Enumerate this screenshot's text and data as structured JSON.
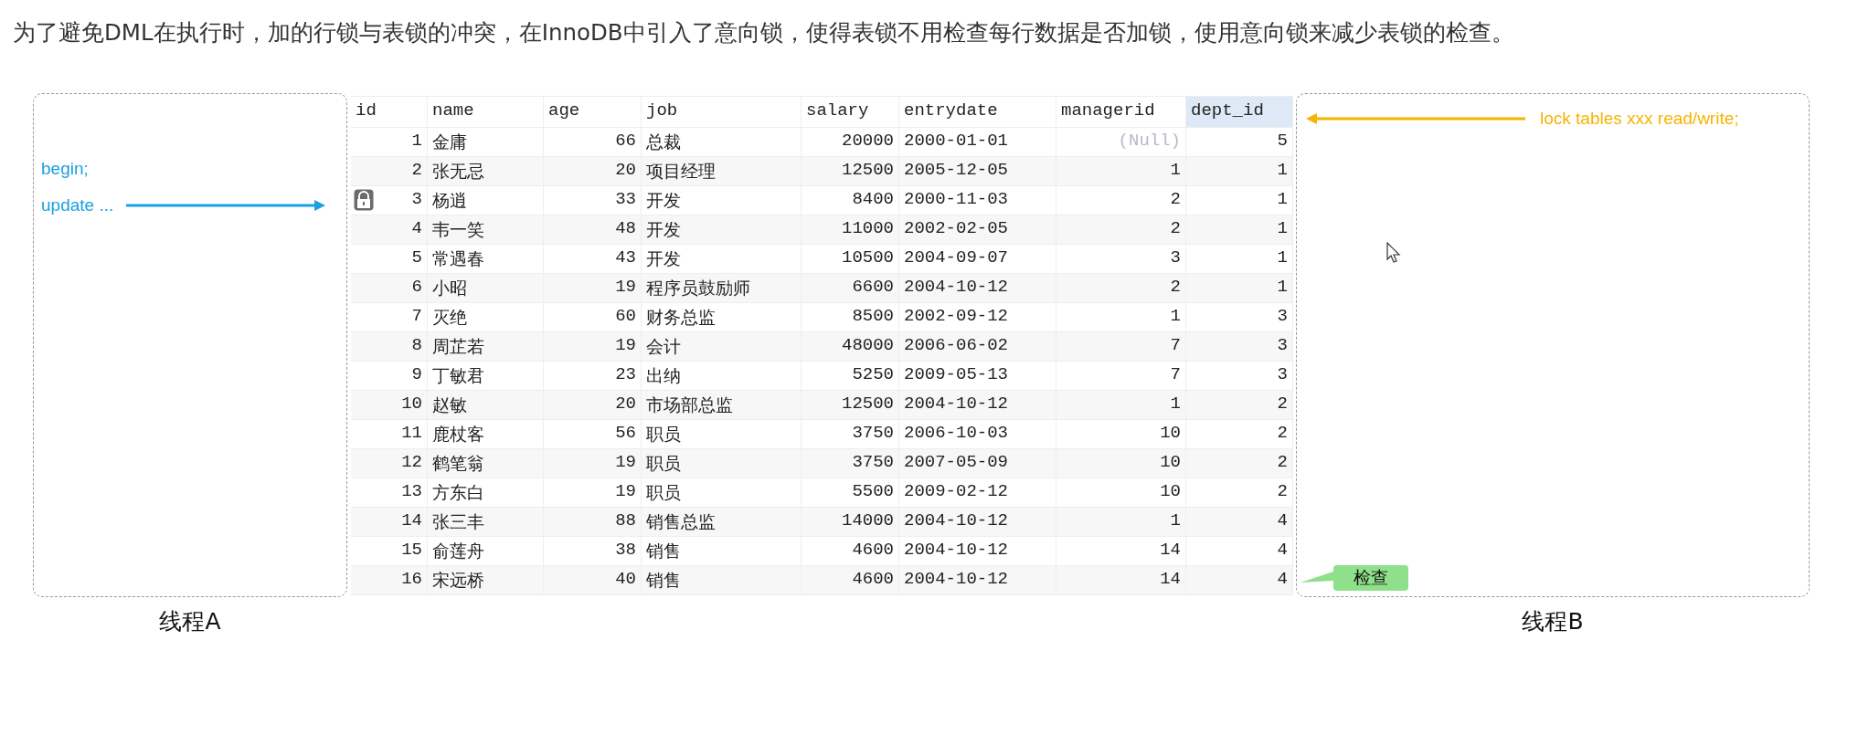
{
  "paragraph": "为了避免DML在执行时，加的行锁与表锁的冲突，在InnoDB中引入了意向锁，使得表锁不用检查每行数据是否加锁，使用意向锁来减少表锁的检查。",
  "thread_a": {
    "label": "线程A",
    "lines": [
      "begin;",
      "update ..."
    ]
  },
  "thread_b": {
    "label": "线程B",
    "command": "lock tables xxx read/write;",
    "badge": "检查"
  },
  "table": {
    "null_label": "(Null)",
    "columns": [
      {
        "label": "id",
        "selected": false
      },
      {
        "label": "name",
        "selected": false
      },
      {
        "label": "age",
        "selected": false
      },
      {
        "label": "job",
        "selected": false
      },
      {
        "label": "salary",
        "selected": false
      },
      {
        "label": "entrydate",
        "selected": false
      },
      {
        "label": "managerid",
        "selected": false
      },
      {
        "label": "dept_id",
        "selected": true
      }
    ],
    "rows": [
      {
        "locked": false,
        "cells": [
          "1",
          "金庸",
          "66",
          "总裁",
          "20000",
          "2000-01-01",
          null,
          "5"
        ]
      },
      {
        "locked": false,
        "cells": [
          "2",
          "张无忌",
          "20",
          "项目经理",
          "12500",
          "2005-12-05",
          "1",
          "1"
        ]
      },
      {
        "locked": true,
        "cells": [
          "3",
          "杨逍",
          "33",
          "开发",
          "8400",
          "2000-11-03",
          "2",
          "1"
        ]
      },
      {
        "locked": false,
        "cells": [
          "4",
          "韦一笑",
          "48",
          "开发",
          "11000",
          "2002-02-05",
          "2",
          "1"
        ]
      },
      {
        "locked": false,
        "cells": [
          "5",
          "常遇春",
          "43",
          "开发",
          "10500",
          "2004-09-07",
          "3",
          "1"
        ]
      },
      {
        "locked": false,
        "cells": [
          "6",
          "小昭",
          "19",
          "程序员鼓励师",
          "6600",
          "2004-10-12",
          "2",
          "1"
        ]
      },
      {
        "locked": false,
        "cells": [
          "7",
          "灭绝",
          "60",
          "财务总监",
          "8500",
          "2002-09-12",
          "1",
          "3"
        ]
      },
      {
        "locked": false,
        "cells": [
          "8",
          "周芷若",
          "19",
          "会计",
          "48000",
          "2006-06-02",
          "7",
          "3"
        ]
      },
      {
        "locked": false,
        "cells": [
          "9",
          "丁敏君",
          "23",
          "出纳",
          "5250",
          "2009-05-13",
          "7",
          "3"
        ]
      },
      {
        "locked": false,
        "cells": [
          "10",
          "赵敏",
          "20",
          "市场部总监",
          "12500",
          "2004-10-12",
          "1",
          "2"
        ]
      },
      {
        "locked": false,
        "cells": [
          "11",
          "鹿杖客",
          "56",
          "职员",
          "3750",
          "2006-10-03",
          "10",
          "2"
        ]
      },
      {
        "locked": false,
        "cells": [
          "12",
          "鹤笔翁",
          "19",
          "职员",
          "3750",
          "2007-05-09",
          "10",
          "2"
        ]
      },
      {
        "locked": false,
        "cells": [
          "13",
          "方东白",
          "19",
          "职员",
          "5500",
          "2009-02-12",
          "10",
          "2"
        ]
      },
      {
        "locked": false,
        "cells": [
          "14",
          "张三丰",
          "88",
          "销售总监",
          "14000",
          "2004-10-12",
          "1",
          "4"
        ]
      },
      {
        "locked": false,
        "cells": [
          "15",
          "俞莲舟",
          "38",
          "销售",
          "4600",
          "2004-10-12",
          "14",
          "4"
        ]
      },
      {
        "locked": false,
        "cells": [
          "16",
          "宋远桥",
          "40",
          "销售",
          "4600",
          "2004-10-12",
          "14",
          "4"
        ]
      }
    ]
  }
}
